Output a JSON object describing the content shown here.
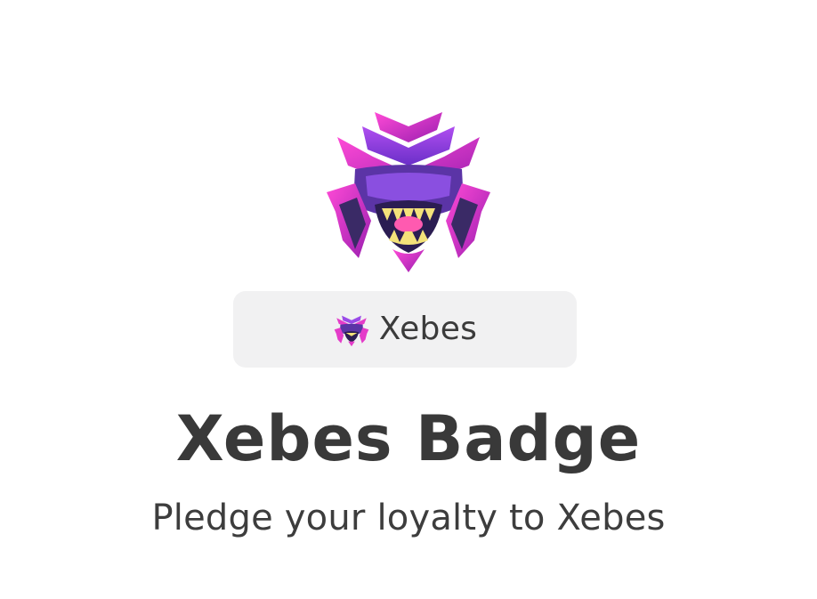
{
  "emblem": {
    "icon": "xebes-emblem-icon",
    "colors": {
      "magenta": "#e43cc9",
      "purple": "#7b3fd8",
      "dark": "#3a2a66",
      "fang": "#f4e27a"
    }
  },
  "tag": {
    "icon": "xebes-mini-emblem-icon",
    "label": "Xebes",
    "background": "#f1f1f2"
  },
  "badge": {
    "title": "Xebes Badge",
    "subtitle": "Pledge your loyalty to Xebes"
  }
}
